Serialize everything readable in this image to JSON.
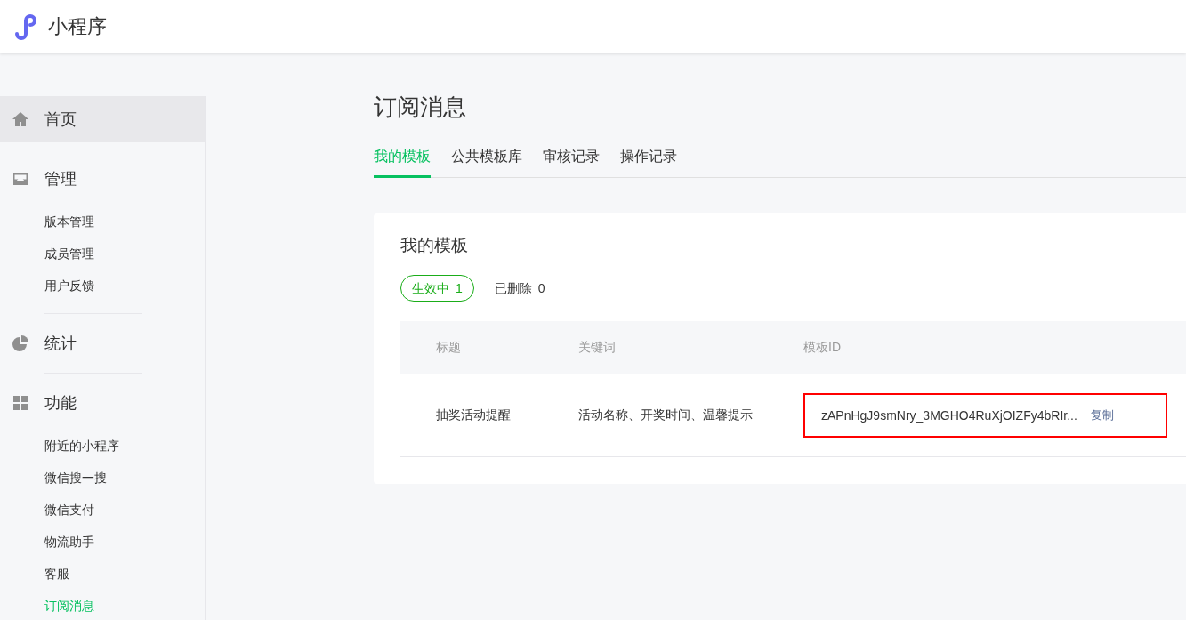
{
  "header": {
    "title": "小程序"
  },
  "sidebar": {
    "groups": [
      {
        "title": "首页",
        "selected": true
      },
      {
        "title": "管理",
        "selected": false,
        "items": [
          {
            "label": "版本管理",
            "selected": false
          },
          {
            "label": "成员管理",
            "selected": false
          },
          {
            "label": "用户反馈",
            "selected": false
          }
        ]
      },
      {
        "title": "统计",
        "selected": false
      },
      {
        "title": "功能",
        "selected": false,
        "items": [
          {
            "label": "附近的小程序",
            "selected": false
          },
          {
            "label": "微信搜一搜",
            "selected": false
          },
          {
            "label": "微信支付",
            "selected": false
          },
          {
            "label": "物流助手",
            "selected": false
          },
          {
            "label": "客服",
            "selected": false
          },
          {
            "label": "订阅消息",
            "selected": true
          }
        ]
      }
    ]
  },
  "page": {
    "title": "订阅消息",
    "tabs": [
      {
        "label": "我的模板",
        "selected": true
      },
      {
        "label": "公共模板库",
        "selected": false
      },
      {
        "label": "审核记录",
        "selected": false
      },
      {
        "label": "操作记录",
        "selected": false
      }
    ],
    "card": {
      "title": "我的模板",
      "filters": [
        {
          "label": "生效中",
          "count": "1",
          "selected": true
        },
        {
          "label": "已删除",
          "count": "0",
          "selected": false
        }
      ],
      "table": {
        "columns": [
          "标题",
          "关键词",
          "模板ID"
        ],
        "rows": [
          {
            "title": "抽奖活动提醒",
            "keywords": "活动名称、开奖时间、温馨提示",
            "template_id": "zAPnHgJ9smNry_3MGHO4RuXjOIZFy4bRIr...",
            "copy_link": "复制",
            "highlighted": true
          }
        ]
      }
    }
  }
}
